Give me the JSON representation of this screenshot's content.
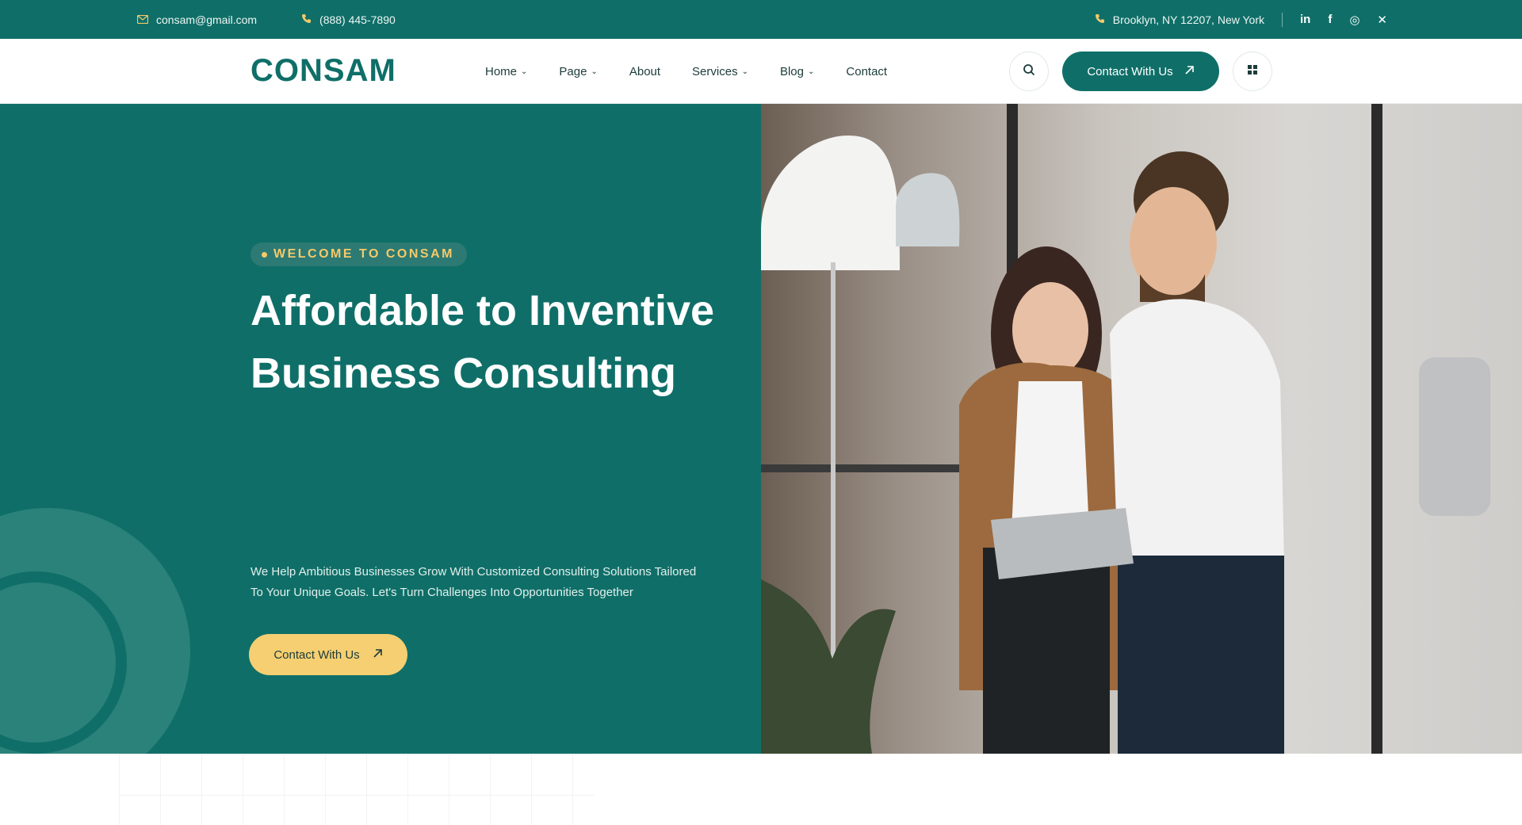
{
  "topbar": {
    "email": "consam@gmail.com",
    "phone": "(888) 445-7890",
    "address": "Brooklyn, NY 12207, New York",
    "social": [
      "in",
      "f",
      "◎",
      "✕"
    ]
  },
  "header": {
    "logo": "CONSAM",
    "nav": [
      {
        "label": "Home"
      },
      {
        "label": "Page"
      },
      {
        "label": "About"
      },
      {
        "label": "Services"
      },
      {
        "label": "Blog"
      },
      {
        "label": "Contact"
      }
    ],
    "contact_button": "Contact With Us"
  },
  "hero": {
    "badge": "WELCOME TO CONSAM",
    "headline_line1": "Affordable to Inventive",
    "headline_line2": "Business Consulting",
    "description_line1": "We Help Ambitious Businesses Grow With Customized Consulting Solutions Tailored",
    "description_line2": "To Your Unique Goals. Let's Turn Challenges Into Opportunities Together",
    "button": "Contact With Us"
  },
  "colors": {
    "primary": "#0f6f68",
    "accent": "#f5c96a"
  },
  "icons": {
    "email": "envelope-icon",
    "phone": "phone-icon",
    "address": "location-icon",
    "search": "search-icon",
    "grid": "grid-icon",
    "arrow": "arrow-up-right-icon"
  }
}
